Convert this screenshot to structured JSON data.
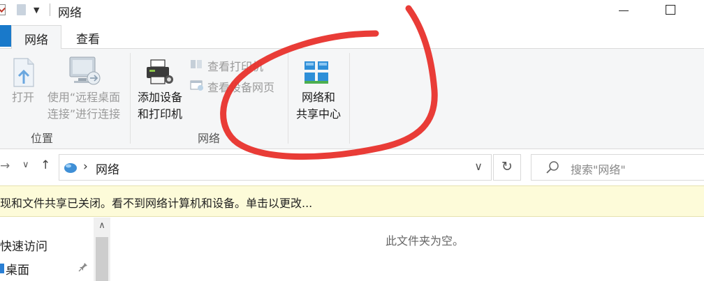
{
  "window": {
    "title": "网络"
  },
  "tabs": [
    {
      "label": "网络"
    },
    {
      "label": "查看"
    }
  ],
  "ribbon": {
    "location_group": {
      "label": "位置",
      "open_label": "打开",
      "remote_line1": "使用“远程桌面",
      "remote_line2": "连接”进行连接"
    },
    "network_group": {
      "label": "网络",
      "add_line1": "添加设备",
      "add_line2": "和打印机",
      "view_printers": "查看打印机",
      "view_device_page": "查看设备网页"
    },
    "center": {
      "line1": "网络和",
      "line2": "共享中心"
    }
  },
  "address": {
    "path": "网络",
    "search_placeholder": "搜索\"网络\""
  },
  "infobar": {
    "text": "现和文件共享已关闭。看不到网络计算机和设备。单击以更改..."
  },
  "navpane": {
    "quick_access": "快速访问",
    "desktop": "桌面"
  },
  "content": {
    "empty_text": "此文件夹为空。"
  },
  "colors": {
    "accent": "#1979ca",
    "annotation": "#e8322c",
    "infobar": "#fdfbd9"
  }
}
